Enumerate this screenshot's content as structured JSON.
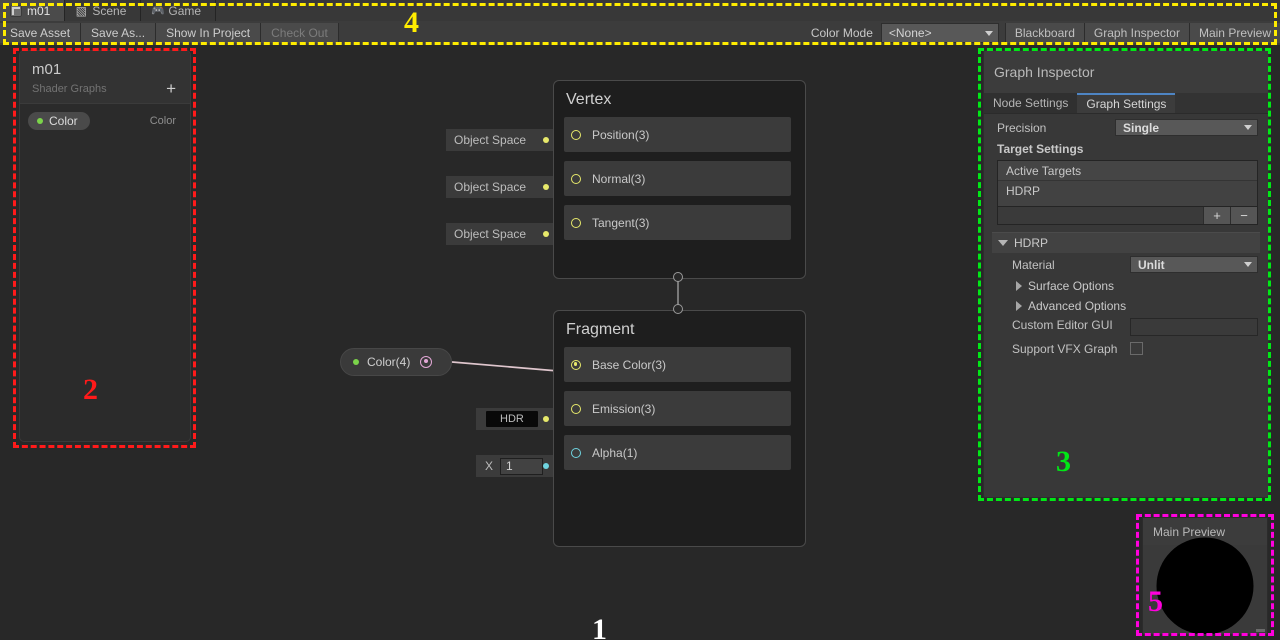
{
  "window": {
    "tabs": [
      {
        "label": "m01",
        "icon": "shader-graph-icon",
        "active": true
      },
      {
        "label": "Scene",
        "icon": "grid-icon",
        "active": false
      },
      {
        "label": "Game",
        "icon": "gamepad-icon",
        "active": false
      }
    ]
  },
  "toolbar": {
    "buttons": [
      {
        "label": "Save Asset",
        "disabled": false
      },
      {
        "label": "Save As...",
        "disabled": false
      },
      {
        "label": "Show In Project",
        "disabled": false
      },
      {
        "label": "Check Out",
        "disabled": true
      }
    ],
    "color_mode_label": "Color Mode",
    "color_mode_value": "<None>",
    "toggles": [
      {
        "label": "Blackboard"
      },
      {
        "label": "Graph Inspector"
      },
      {
        "label": "Main Preview"
      }
    ]
  },
  "blackboard": {
    "title": "m01",
    "subtitle": "Shader Graphs",
    "add_label": "+",
    "properties": [
      {
        "name": "Color",
        "type": "Color",
        "dot_color": "#7bd44a"
      }
    ]
  },
  "graph": {
    "canvas_label": "1",
    "vertex_node": {
      "title": "Vertex",
      "slots": [
        {
          "label": "Position(3)",
          "default_input": "Object Space",
          "port_color": "#e7e96b"
        },
        {
          "label": "Normal(3)",
          "default_input": "Object Space",
          "port_color": "#e7e96b"
        },
        {
          "label": "Tangent(3)",
          "default_input": "Object Space",
          "port_color": "#e7e96b"
        }
      ]
    },
    "fragment_node": {
      "title": "Fragment",
      "slots": [
        {
          "label": "Base Color(3)",
          "default_input": "",
          "port_color": "#e7e96b"
        },
        {
          "label": "Emission(3)",
          "default_input": "HDR",
          "port_color": "#e7e96b"
        },
        {
          "label": "Alpha(1)",
          "default_input": "1",
          "default_input_axis": "X",
          "port_color": "#6fd4e0"
        }
      ]
    },
    "property_node": {
      "label": "Color(4)",
      "dot_color": "#7bd44a",
      "out_port_color": "#e3a7d6"
    },
    "edge_color": "#dfc6cd"
  },
  "inspector": {
    "title": "Graph Inspector",
    "tabs": [
      {
        "label": "Node Settings",
        "active": false
      },
      {
        "label": "Graph Settings",
        "active": true
      }
    ],
    "precision_label": "Precision",
    "precision_value": "Single",
    "target_settings_label": "Target Settings",
    "active_targets_header": "Active Targets",
    "active_targets": [
      "HDRP"
    ],
    "add_target_icon": "plus-icon",
    "remove_target_icon": "minus-icon",
    "add_target_label": "+",
    "remove_target_label": "−",
    "hdrp_foldout_label": "HDRP",
    "material_label": "Material",
    "material_value": "Unlit",
    "surface_options_label": "Surface Options",
    "advanced_options_label": "Advanced Options",
    "custom_editor_gui_label": "Custom Editor GUI",
    "custom_editor_gui_value": "",
    "support_vfx_graph_label": "Support VFX Graph",
    "label_3": "3"
  },
  "main_preview": {
    "title": "Main Preview",
    "label_5": "5"
  },
  "annotations": {
    "items": [
      {
        "id": "1",
        "label": "1",
        "color": "#ffffff",
        "target": "graph-canvas"
      },
      {
        "id": "2",
        "label": "2",
        "color": "#ff1a1a",
        "target": "blackboard"
      },
      {
        "id": "3",
        "label": "3",
        "color": "#00e816",
        "target": "graph-inspector"
      },
      {
        "id": "4",
        "label": "4",
        "color": "#ffec00",
        "target": "toolbar"
      },
      {
        "id": "5",
        "label": "5",
        "color": "#ff00dd",
        "target": "main-preview"
      }
    ],
    "colors": {
      "red": "#ff1a1a",
      "green": "#00e816",
      "yellow": "#ffec00",
      "magenta": "#ff00dd",
      "white": "#ffffff"
    }
  }
}
